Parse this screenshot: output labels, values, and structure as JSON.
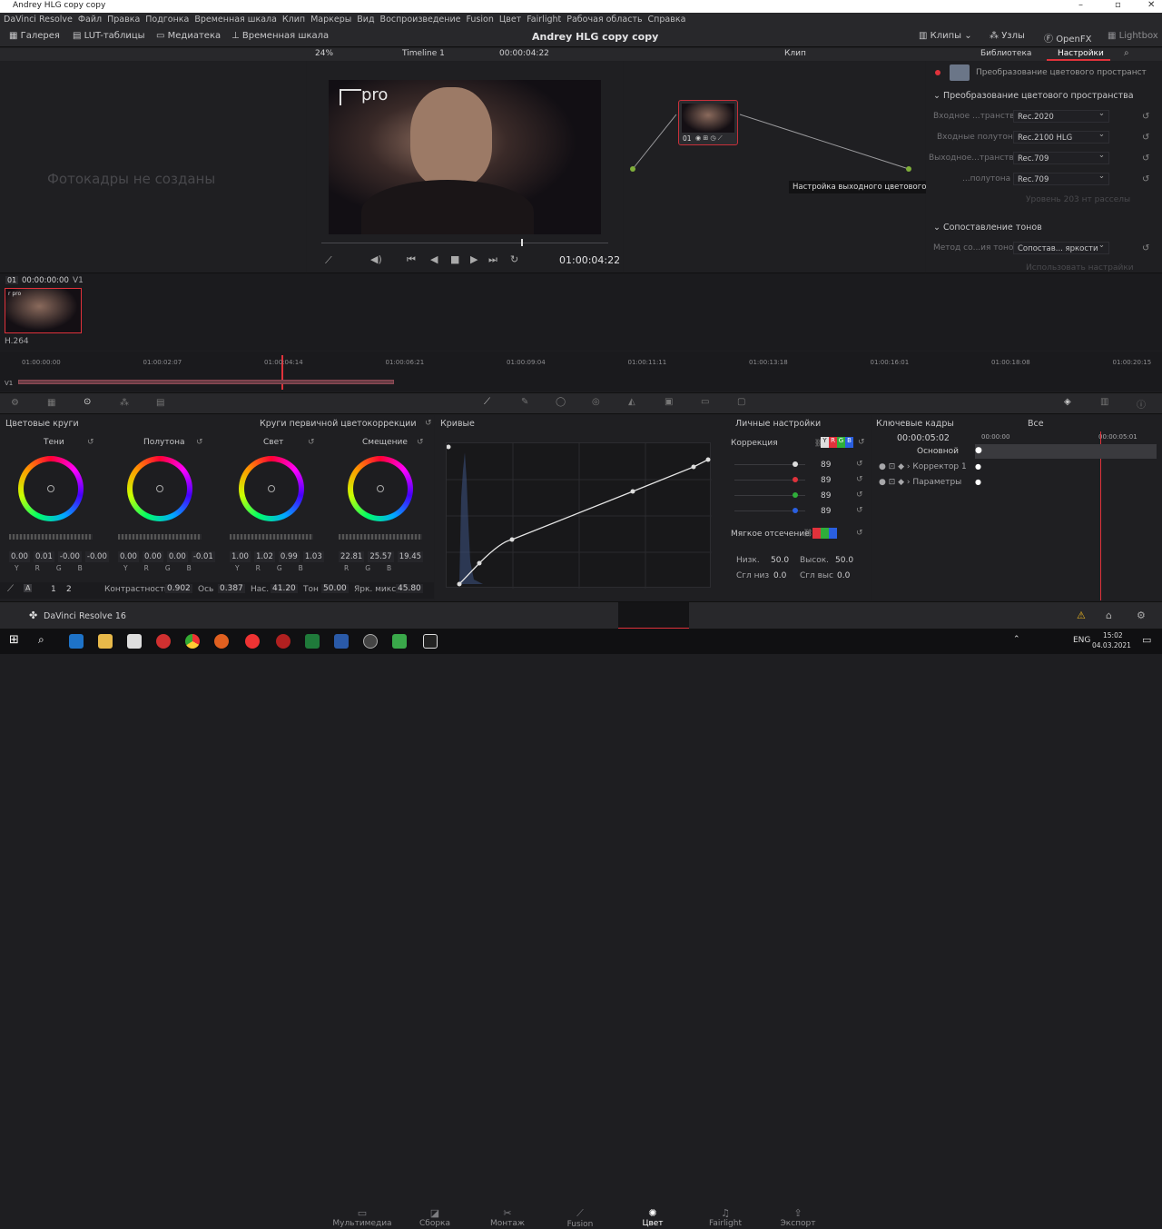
{
  "window": {
    "title": "Andrey HLG copy copy"
  },
  "menu": [
    "DaVinci Resolve",
    "Файл",
    "Правка",
    "Подгонка",
    "Временная шкала",
    "Клип",
    "Маркеры",
    "Вид",
    "Воспроизведение",
    "Fusion",
    "Цвет",
    "Fairlight",
    "Рабочая область",
    "Справка"
  ],
  "toolbar": {
    "gallery": "Галерея",
    "lut": "LUT-таблицы",
    "media": "Медиатека",
    "timeline": "Временная шкала",
    "project_title": "Andrey HLG copy copy",
    "clips": "Клипы",
    "nodes": "Узлы",
    "openfx": "OpenFX",
    "lightbox": "Lightbox"
  },
  "viewer": {
    "zoom": "24%",
    "timeline_name": "Timeline 1",
    "timecode_top": "00:00:04:22",
    "clip_label": "Клип",
    "timecode": "01:00:04:22",
    "logo": "pro"
  },
  "gallery": {
    "empty_text": "Фотокадры не созданы"
  },
  "clip_strip": {
    "num": "01",
    "tc": "00:00:00:00",
    "track": "V1",
    "codec": "H.264",
    "thumb_text": "r pro"
  },
  "node": {
    "label": "01",
    "tooltip": "Настройка выходного цветового пространства"
  },
  "settings": {
    "tab_library": "Библиотека",
    "tab_settings": "Настройки",
    "effect_name": "Преобразование цветового пространст",
    "section1": "Преобразование цветового пространства",
    "rows": [
      {
        "label": "Входное ...транство",
        "value": "Rec.2020"
      },
      {
        "label": "Входные полутона",
        "value": "Rec.2100 HLG"
      },
      {
        "label": "Выходное...транство",
        "value": "Rec.709"
      },
      {
        "label": "...полутона",
        "value": "Rec.709"
      }
    ],
    "faded": "Уровень 203 нт расселы",
    "section2": "Сопоставление тонов",
    "tone_label": "Метод со...ия тонов",
    "tone_value": "Сопостав... яркости",
    "faded2": "Использовать настрайки"
  },
  "timeline": {
    "ticks": [
      "01:00:00:00",
      "01:00:02:07",
      "01:00:04:14",
      "01:00:06:21",
      "01:00:09:04",
      "01:00:11:11",
      "01:00:13:18",
      "01:00:16:01",
      "01:00:18:08",
      "01:00:20:15"
    ],
    "track": "V1"
  },
  "wheels": {
    "panel_title": "Цветовые круги",
    "mode": "Круги первичной цветокоррекции",
    "items": [
      {
        "name": "Тени",
        "vals": [
          "0.00",
          "0.01",
          "-0.00",
          "-0.00"
        ]
      },
      {
        "name": "Полутона",
        "vals": [
          "0.00",
          "0.00",
          "0.00",
          "-0.01"
        ]
      },
      {
        "name": "Свет",
        "vals": [
          "1.00",
          "1.02",
          "0.99",
          "1.03"
        ]
      },
      {
        "name": "Смещение",
        "vals": [
          "22.81",
          "25.57",
          "19.45"
        ]
      }
    ],
    "ch4": [
      "Y",
      "R",
      "G",
      "B"
    ],
    "ch3": [
      "R",
      "G",
      "B"
    ],
    "page1": "1",
    "page2": "2",
    "contrast_lbl": "Контрастность",
    "contrast": "0.902",
    "pivot_lbl": "Ось",
    "pivot": "0.387",
    "sat_lbl": "Нас.",
    "sat": "41.20",
    "hue_lbl": "Тон",
    "hue": "50.00",
    "lum_lbl": "Ярк. микс",
    "lum": "45.80"
  },
  "curves": {
    "title": "Кривые",
    "custom": "Личные настройки",
    "correction": "Коррекция",
    "ch_y": "Y",
    "ch_r": "R",
    "ch_g": "G",
    "ch_b": "B",
    "vals": [
      "89",
      "89",
      "89",
      "89"
    ],
    "soft_clip": "Мягкое отсечение",
    "low_lbl": "Низк.",
    "low": "50.0",
    "high_lbl": "Высок.",
    "high": "50.0",
    "low_soft_lbl": "Сгл низ",
    "low_soft": "0.0",
    "high_soft_lbl": "Сгл выс",
    "high_soft": "0.0"
  },
  "keyframes": {
    "title": "Ключевые кадры",
    "filter": "Все",
    "tc": "00:00:05:02",
    "tc_start": "00:00:00",
    "tc_end": "00:00:05:01",
    "rows": [
      "Основной",
      "Корректор 1",
      "Параметры"
    ]
  },
  "pages": [
    "Мультимедиа",
    "Сборка",
    "Монтаж",
    "Fusion",
    "Цвет",
    "Fairlight",
    "Экспорт"
  ],
  "app_name": "DaVinci Resolve 16",
  "taskbar": {
    "lang": "ENG",
    "time": "15:02",
    "date": "04.03.2021"
  },
  "colors": {
    "accent_red": "#e0323b",
    "node_border": "#c8303a"
  }
}
